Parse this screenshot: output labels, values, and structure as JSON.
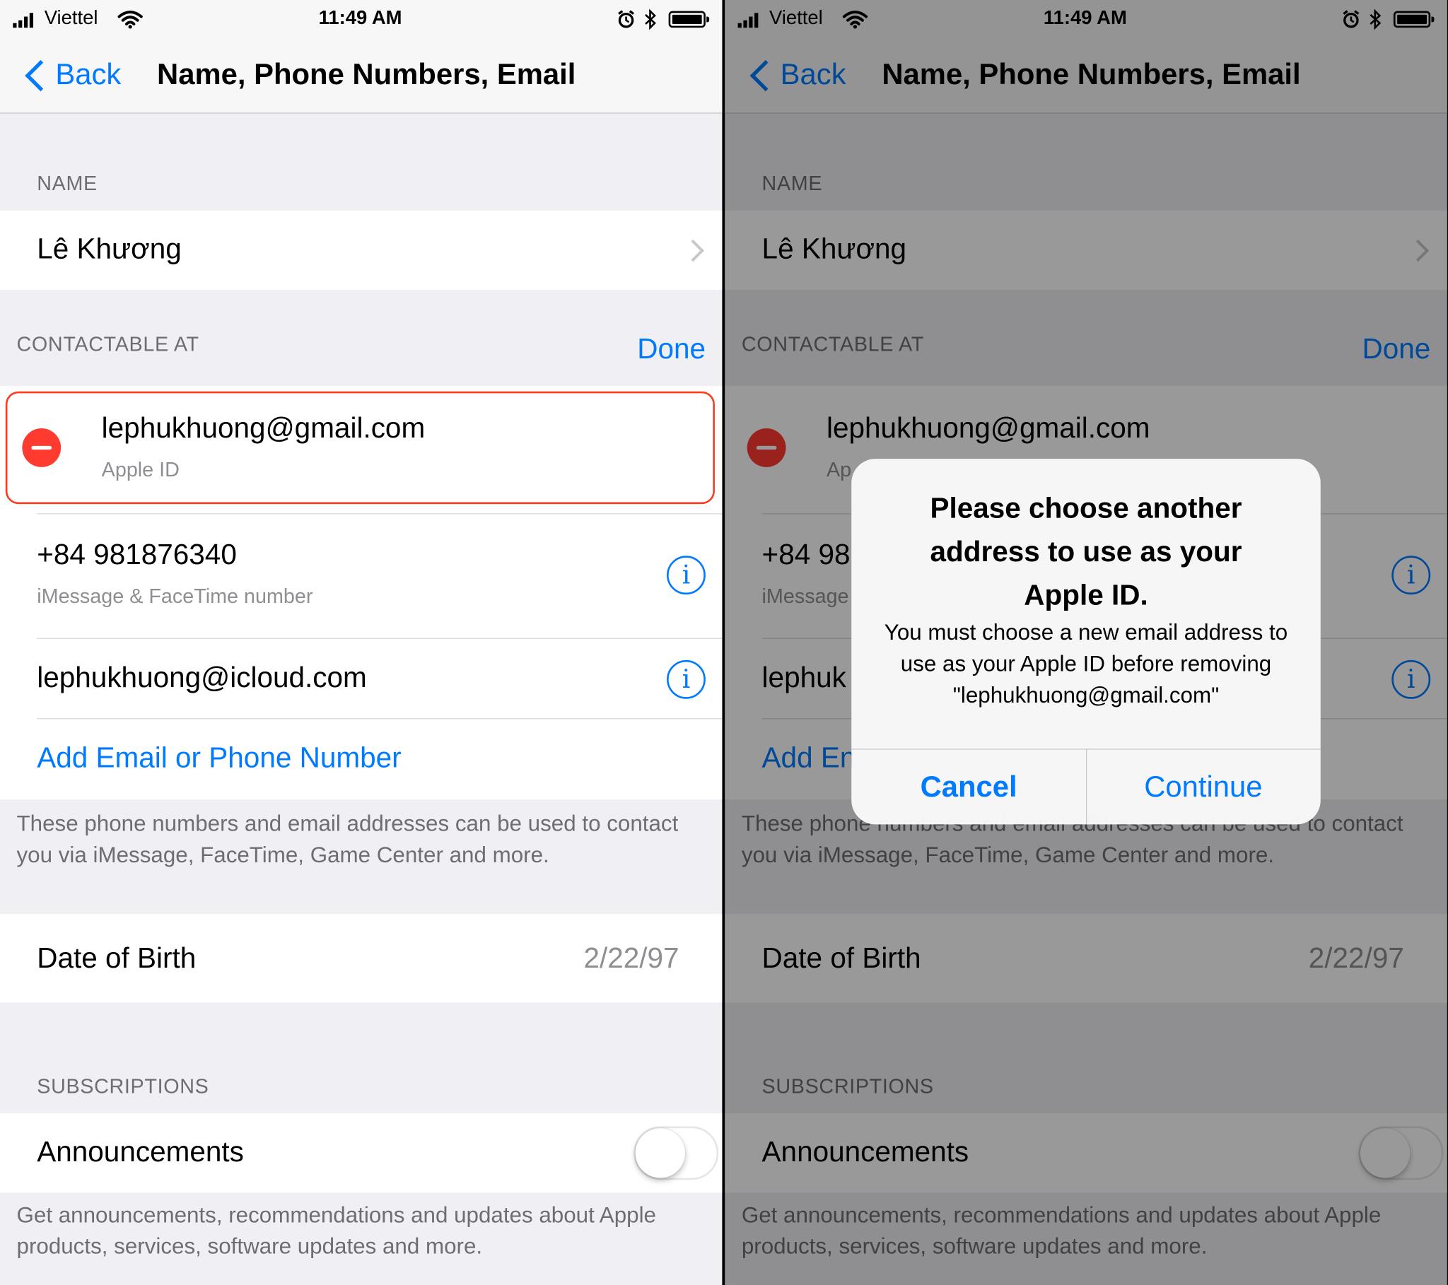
{
  "status_bar": {
    "carrier": "Viettel",
    "time": "11:49 AM"
  },
  "nav": {
    "back_label": "Back",
    "title": "Name, Phone Numbers, Email"
  },
  "name_section": {
    "header": "NAME",
    "full_name": "Lê  Khương"
  },
  "contactable": {
    "header": "CONTACTABLE AT",
    "done_label": "Done",
    "items": [
      {
        "value": "lephukhuong@gmail.com",
        "subtitle": "Apple ID"
      },
      {
        "value": "+84 981876340",
        "subtitle": "iMessage & FaceTime number"
      },
      {
        "value": "lephukhuong@icloud.com",
        "subtitle": ""
      }
    ],
    "add_label": "Add Email or Phone Number",
    "footer": "These phone numbers and email addresses can be used to contact you via iMessage, FaceTime, Game Center and more."
  },
  "dob": {
    "label": "Date of Birth",
    "value": "2/22/97"
  },
  "subscriptions": {
    "header": "SUBSCRIPTIONS",
    "announcements_label": "Announcements",
    "announcements_on": false,
    "footer": "Get announcements, recommendations and updates about Apple products, services, software updates and more."
  },
  "alert": {
    "title": "Please choose another address to use as your Apple ID.",
    "message": "You must choose a new email address to use as your Apple ID before removing \"lephukhuong@gmail.com\"",
    "cancel_label": "Cancel",
    "continue_label": "Continue"
  },
  "right_partial": {
    "apple_id_fragment": "Ap",
    "phone_fragment": "+84 98",
    "imessage_fragment": "iMessage",
    "icloud_fragment": "lephuk",
    "add_fragment": "Add En"
  },
  "colors": {
    "tint": "#007aff",
    "destructive": "#ff3b30",
    "highlight_border": "#ff3b1f",
    "grouped_bg": "#efeff4"
  },
  "icons": [
    "signal-bars-icon",
    "wifi-icon",
    "alarm-icon",
    "bluetooth-icon",
    "battery-icon",
    "back-chevron-icon",
    "disclosure-chevron-icon",
    "delete-minus-icon",
    "info-icon"
  ]
}
